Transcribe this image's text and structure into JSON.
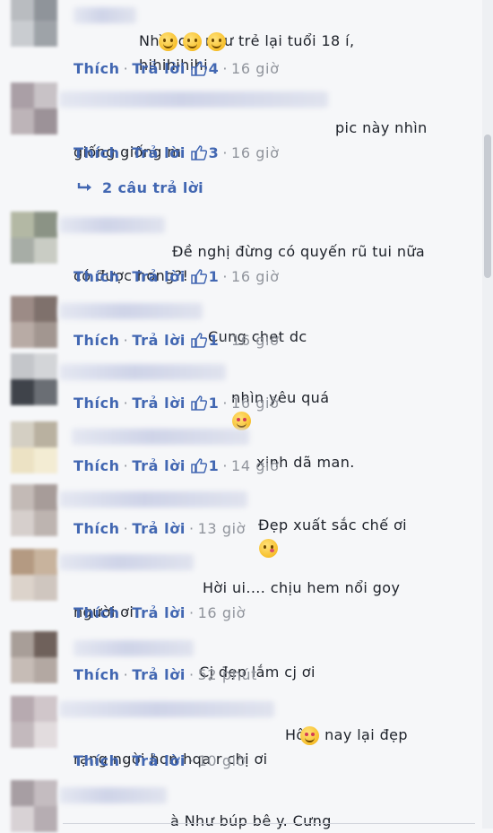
{
  "ui": {
    "like_label": "Thích",
    "reply_label": "Trả lời",
    "separator": "·"
  },
  "comments": [
    {
      "text": "Nhìn chị như trẻ lại tuổi 18 í,\nhihihihihi",
      "emoji": [
        "smile",
        "smile",
        "smile"
      ],
      "likes": "4",
      "time": "16 giờ"
    },
    {
      "text": "pic này nhìn\ngiống giống m",
      "emoji": [],
      "likes": "3",
      "time": "16 giờ",
      "replies": "2 câu trả lời"
    },
    {
      "text": "Đề nghị đừng có quyến rũ tui nữa\ncó được hong?!",
      "emoji": [],
      "likes": "1",
      "time": "16 giờ"
    },
    {
      "text": "Cung chet dc",
      "emoji": [],
      "likes": "1",
      "time": "16 giờ"
    },
    {
      "text": "nhìn yêu quá",
      "emoji": [
        "heart"
      ],
      "likes": "1",
      "time": "16 giờ"
    },
    {
      "text": "xinh dã man.",
      "emoji": [],
      "likes": "1",
      "time": "14 giờ"
    },
    {
      "text": "Đẹp xuất sắc chế ơi",
      "emoji": [
        "kiss"
      ],
      "likes": "",
      "time": "13 giờ"
    },
    {
      "text": "Hời ui.... chịu hem nổi goy\nngười ơi",
      "emoji": [],
      "likes": "",
      "time": "16 giờ"
    },
    {
      "text": "Cj đẹp lắm cj ơi",
      "emoji": [],
      "likes": "",
      "time": "52 phút"
    },
    {
      "text": "Hôm nay lại đẹp\nrạng ngời hơn hqa r chị ơi",
      "emoji": [
        "heart"
      ],
      "likes": "",
      "time": "10 giờ"
    },
    {
      "text": "à Như búp bê y. Cưng",
      "emoji": [],
      "likes": "",
      "time": ""
    }
  ]
}
